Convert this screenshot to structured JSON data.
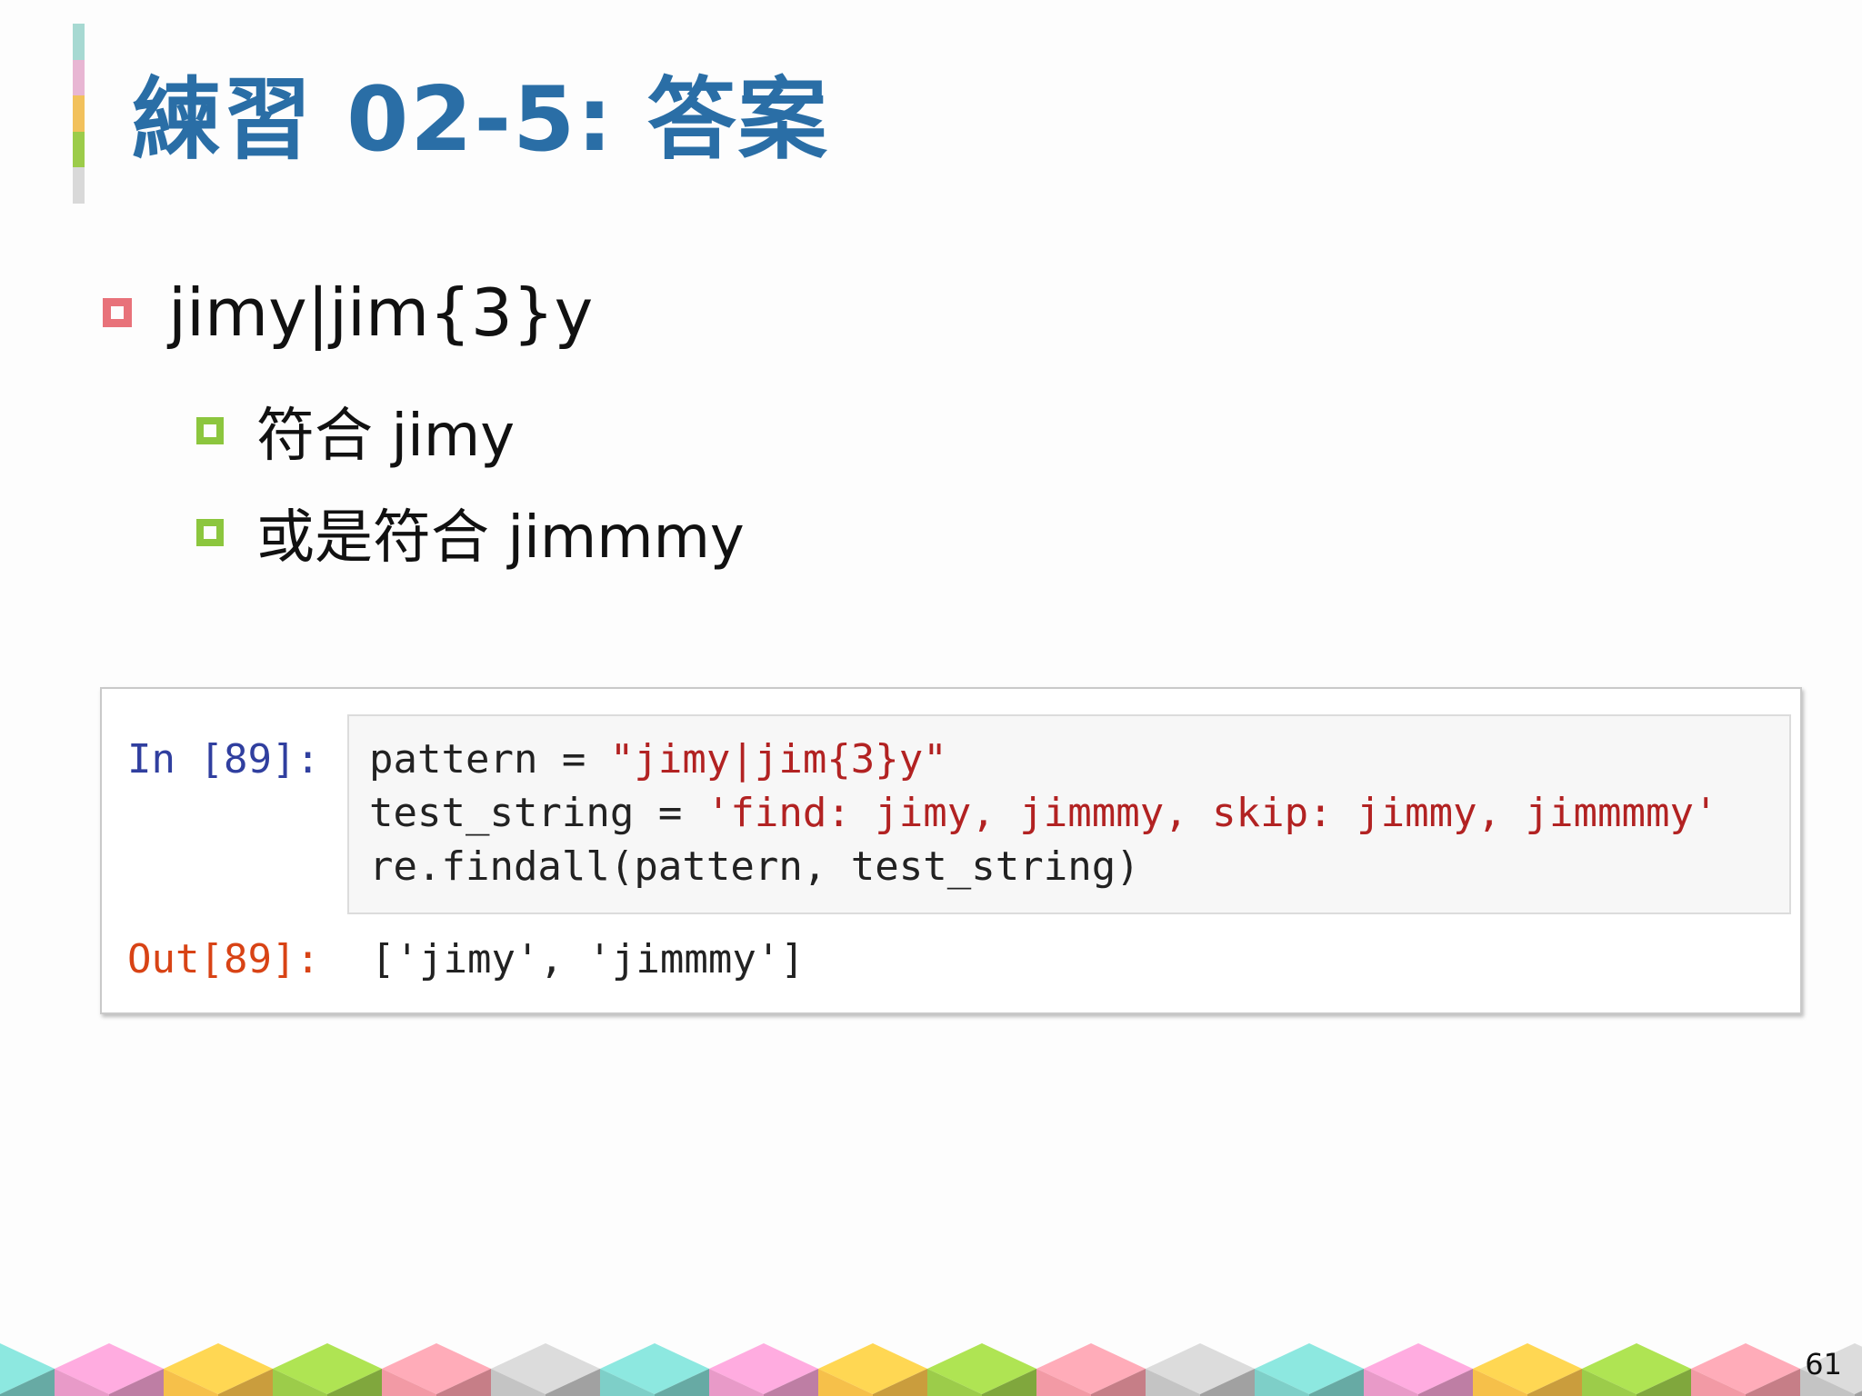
{
  "slide": {
    "title": "練習 02-5: 答案",
    "page_number": "61"
  },
  "colors": {
    "title": "#2a6ea6",
    "bar": [
      "#a7d9d2",
      "#e8b6d3",
      "#f2c15c",
      "#9ccc4a",
      "#d9d9d9"
    ],
    "bullet_l1": "#e8727a",
    "bullet_l2": "#8cc63e",
    "cubes": [
      "#7ecfc8",
      "#e89ac8",
      "#f6c04a",
      "#9ccc4a",
      "#f29aa5",
      "#c4c4c4"
    ]
  },
  "bullets": {
    "level1": "jimy|jim{3}y",
    "level2": [
      "符合 jimy",
      "或是符合 jimmmy"
    ]
  },
  "notebook": {
    "in_prompt": "In [89]:",
    "code": {
      "line1_prefix": "pattern = ",
      "line1_string": "\"jimy|jim{3}y\"",
      "line2_prefix": "test_string = ",
      "line2_string": "'find: jimy, jimmmy, skip: jimmy, jimmmmy'",
      "line3": "re.findall(pattern, test_string)"
    },
    "out_prompt": "Out[89]:",
    "output": "['jimy', 'jimmmy']"
  }
}
